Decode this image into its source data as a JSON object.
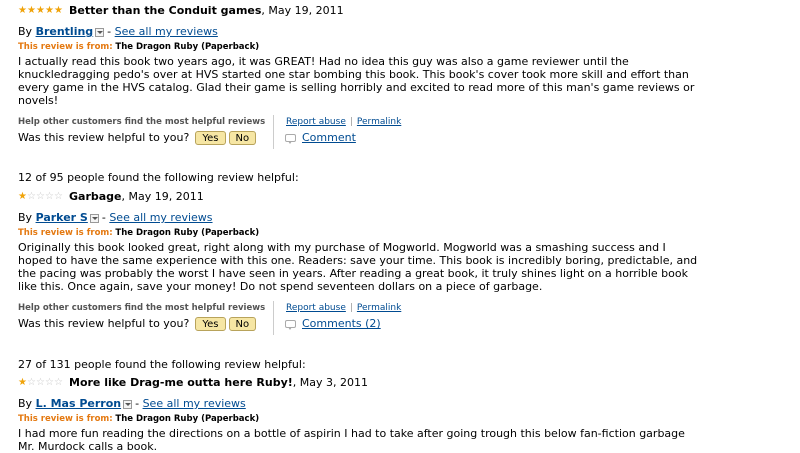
{
  "colors": {
    "link": "#004b91",
    "review_from_label": "#e47911",
    "star_on": "#f0a30a",
    "star_off": "#c8c8c8",
    "vote_button": "#f6e6a4"
  },
  "common": {
    "by": "By",
    "see_all_label": "See all my reviews",
    "review_from_label": "This review is from:",
    "help_others": "Help other customers find the most helpful reviews",
    "helpful_question": "Was this review helpful to you?",
    "yes": "Yes",
    "no": "No",
    "report_abuse": "Report abuse",
    "permalink": "Permalink",
    "separator": "|",
    "dash": "-"
  },
  "reviews": [
    {
      "helpful_count": "",
      "rating": 5,
      "title": "Better than the Conduit games",
      "date": ", May 19, 2011",
      "reviewer": "Brentling",
      "product": "The Dragon Ruby (Paperback)",
      "body": "I actually read this book two years ago, it was GREAT! Had no idea this guy was also a game reviewer until the knuckledragging pedo's over at HVS started one star bombing this book. This book's cover took more skill and effort than every game in the HVS catalog. Glad their game is selling horribly and excited to read more of this man's game reviews or novels!",
      "comment_label": "Comment"
    },
    {
      "helpful_count": "12 of 95 people found the following review helpful:",
      "rating": 1,
      "title": "Garbage",
      "date": ", May 19, 2011",
      "reviewer": "Parker S",
      "product": "The Dragon Ruby (Paperback)",
      "body": "Originally this book looked great, right along with my purchase of Mogworld. Mogworld was a smashing success and I hoped to have the same experience with this one. Readers: save your time. This book is incredibly boring, predictable, and the pacing was probably the worst I have seen in years. After reading a great book, it truly shines light on a horrible book like this. Once again, save your money! Do not spend seventeen dollars on a piece of garbage.",
      "comment_label": "Comments (2)"
    },
    {
      "helpful_count": "27 of 131 people found the following review helpful:",
      "rating": 1,
      "title": "More like Drag-me outta here Ruby!",
      "date": ", May 3, 2011",
      "reviewer": "L. Mas Perron",
      "product": "The Dragon Ruby (Paperback)",
      "body": "I had more fun reading the directions on a bottle of aspirin I had to take after going trough this below fan-fiction garbage Mr. Murdock calls a book.",
      "comment_label": ""
    }
  ]
}
